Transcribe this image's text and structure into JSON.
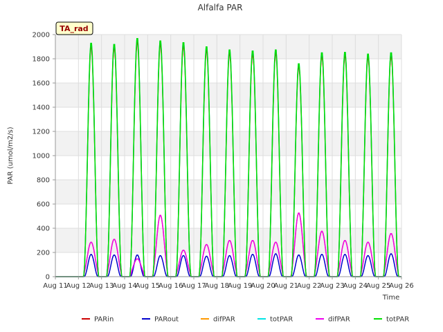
{
  "chart_data": {
    "type": "line",
    "title": "Alfalfa PAR",
    "xlabel": "Time",
    "ylabel": "PAR (umol/m2/s)",
    "badge": "TA_rad",
    "xticks": [
      "Aug 11",
      "Aug 12",
      "Aug 13",
      "Aug 14",
      "Aug 15",
      "Aug 16",
      "Aug 17",
      "Aug 18",
      "Aug 19",
      "Aug 20",
      "Aug 21",
      "Aug 22",
      "Aug 23",
      "Aug 24",
      "Aug 25",
      "Aug 26"
    ],
    "yticks": [
      0,
      200,
      400,
      600,
      800,
      1000,
      1200,
      1400,
      1600,
      1800,
      2000
    ],
    "ylim": [
      0,
      2000
    ],
    "xlim_days": [
      0,
      15
    ],
    "grid": true,
    "legend_position": "bottom",
    "days": [
      "Aug 11",
      "Aug 12",
      "Aug 13",
      "Aug 14",
      "Aug 15",
      "Aug 16",
      "Aug 17",
      "Aug 18",
      "Aug 19",
      "Aug 20",
      "Aug 21",
      "Aug 22",
      "Aug 23",
      "Aug 24",
      "Aug 25"
    ],
    "daily_peak_totPAR": [
      null,
      1940,
      1930,
      1980,
      1960,
      1945,
      1910,
      1885,
      1875,
      1885,
      1770,
      1860,
      1865,
      1850,
      1860
    ],
    "daily_peak_difPAR": [
      null,
      285,
      310,
      140,
      520,
      215,
      265,
      300,
      300,
      285,
      540,
      380,
      300,
      285,
      360
    ],
    "daily_peak_PARout": [
      null,
      185,
      180,
      180,
      175,
      175,
      170,
      175,
      185,
      190,
      180,
      185,
      185,
      175,
      190
    ],
    "series": [
      {
        "name": "PARin",
        "color": "#cc0000"
      },
      {
        "name": "PARout",
        "color": "#0000cc"
      },
      {
        "name": "difPAR",
        "color": "#ff9900"
      },
      {
        "name": "totPAR",
        "color": "#00e5e5"
      },
      {
        "name": "difPAR",
        "color": "#ee00ee"
      },
      {
        "name": "totPAR",
        "color": "#00e000"
      }
    ]
  }
}
